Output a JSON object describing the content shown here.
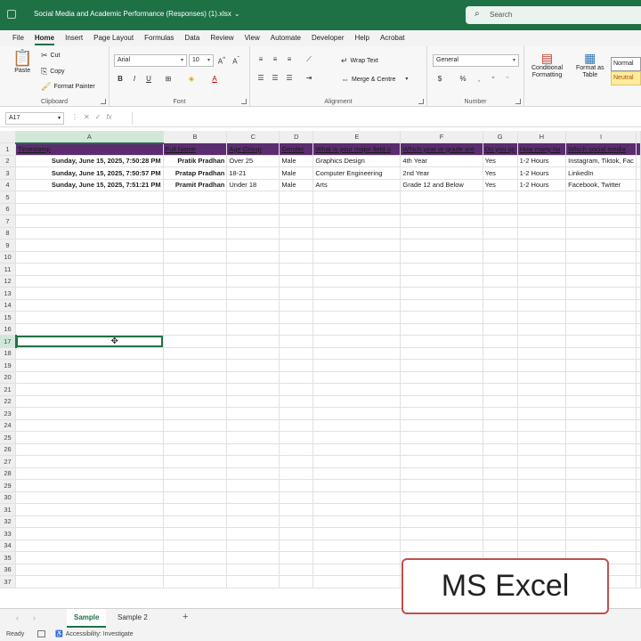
{
  "titlebar": {
    "doc_title": "Social Media and Academic Performance (Responses) (1).xlsx",
    "search_placeholder": "Search"
  },
  "ribbon_tabs": [
    "File",
    "Home",
    "Insert",
    "Page Layout",
    "Formulas",
    "Data",
    "Review",
    "View",
    "Automate",
    "Developer",
    "Help",
    "Acrobat"
  ],
  "active_tab": "Home",
  "ribbon": {
    "clipboard": {
      "paste": "Paste",
      "cut": "Cut",
      "copy": "Copy",
      "format_painter": "Format Painter",
      "label": "Clipboard"
    },
    "font": {
      "name": "Arial",
      "size": "10",
      "label": "Font"
    },
    "alignment": {
      "wrap_text": "Wrap Text",
      "merge_centre": "Merge & Centre",
      "label": "Alignment"
    },
    "number": {
      "format": "General",
      "label": "Number"
    },
    "styles": {
      "conditional": "Conditional",
      "conditional2": "Formatting",
      "format_as": "Format as",
      "table": "Table",
      "normal": "Normal",
      "neutral": "Neutral"
    }
  },
  "formula_bar": {
    "name_box": "A17",
    "fx": "fx",
    "value": ""
  },
  "columns": [
    "A",
    "B",
    "C",
    "D",
    "E",
    "F",
    "G",
    "H",
    "I"
  ],
  "header_row": [
    "Timestamp",
    "Full Name",
    "Age Group",
    "Gender",
    "What is your major field o",
    "Which year or grade are",
    "Do you sp",
    "How many ho",
    "Which social media"
  ],
  "rows": [
    [
      "Sunday, June 15, 2025, 7:50:28 PM",
      "Pratik Pradhan",
      "Over 25",
      "Male",
      "Graphics Design",
      "4th Year",
      "Yes",
      "1-2 Hours",
      "Instagram, Tiktok, Fac"
    ],
    [
      "Sunday, June 15, 2025, 7:50:57 PM",
      "Pratap Pradhan",
      "18-21",
      "Male",
      "Computer Engineering",
      "2nd Year",
      "Yes",
      "1-2 Hours",
      "LinkedIn"
    ],
    [
      "Sunday, June 15, 2025, 7:51:21 PM",
      "Pramit Pradhan",
      "Under 18",
      "Male",
      "Arts",
      "Grade 12 and Below",
      "Yes",
      "1-2 Hours",
      "Facebook, Twitter"
    ]
  ],
  "selected_cell": {
    "row": 17,
    "col": "A"
  },
  "row_count": 37,
  "sheets": [
    "Sample",
    "Sample 2"
  ],
  "active_sheet": "Sample",
  "status": {
    "ready": "Ready",
    "accessibility": "Accessibility: Investigate"
  },
  "overlay_label": "MS Excel",
  "colors": {
    "brand": "#1e7145",
    "header_fill": "#5b2c6f",
    "overlay_border": "#c0504d"
  }
}
